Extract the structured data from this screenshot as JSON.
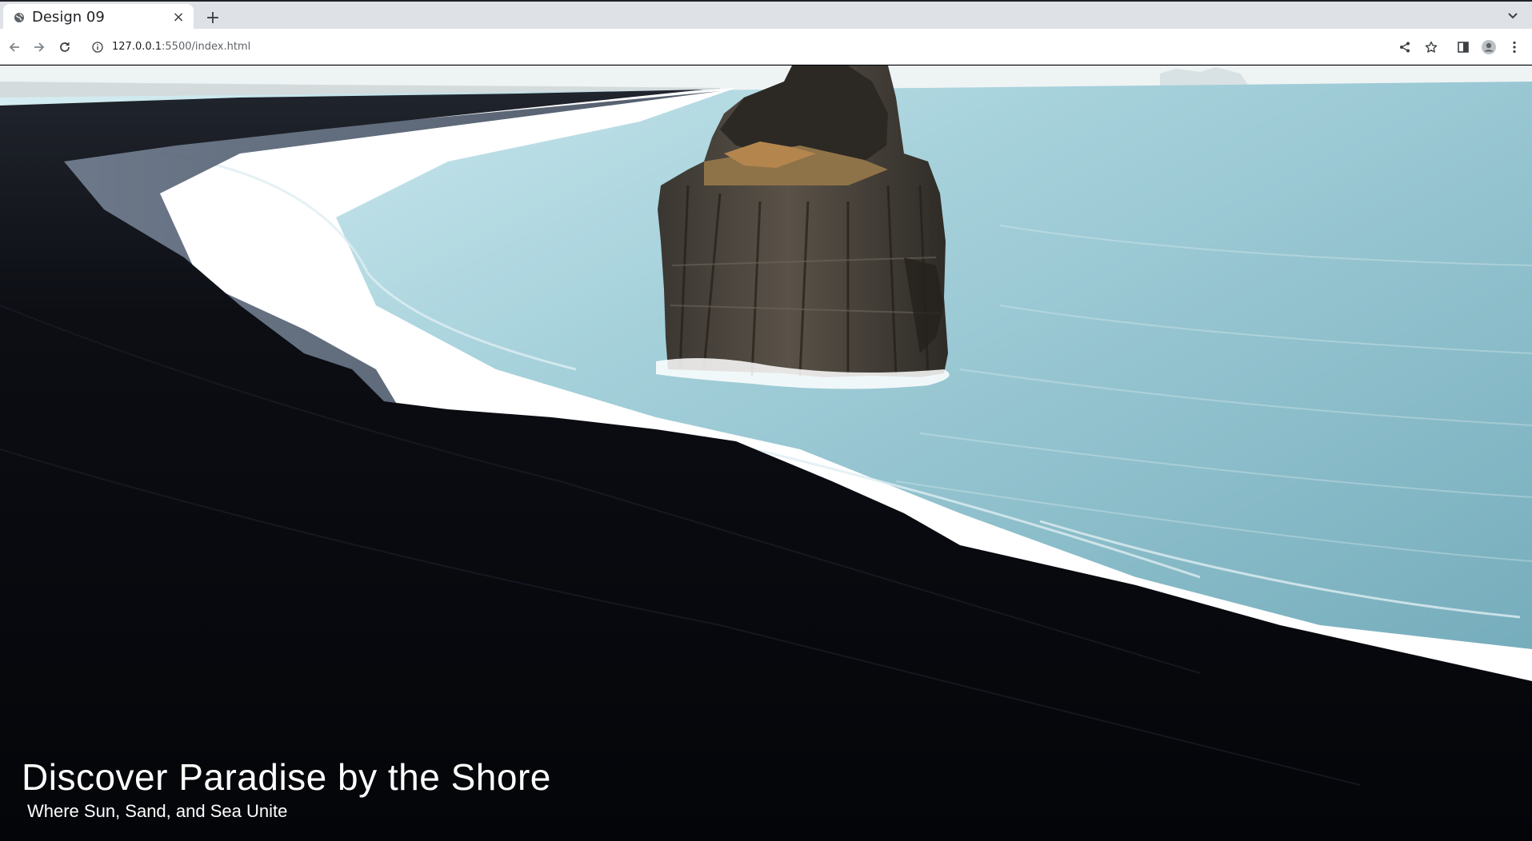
{
  "browser": {
    "tab": {
      "title": "Design 09",
      "favicon": "globe-icon"
    },
    "new_tab_label": "+",
    "close_label": "×",
    "url": {
      "host": "127.0.0.1",
      "rest": ":5500/index.html"
    },
    "icons": [
      "back-icon",
      "forward-icon",
      "reload-icon",
      "info-icon",
      "share-icon",
      "star-icon",
      "side-panel-icon",
      "profile-icon",
      "menu-icon",
      "tab-search-icon"
    ]
  },
  "hero": {
    "title": "Discover Paradise by the Shore",
    "subtitle": "Where Sun, Sand, and Sea Unite"
  },
  "colors": {
    "sand": "#07080d",
    "sea": "#7fb6c4",
    "foam": "#ffffff",
    "mist": "#e6eef0",
    "rock": "#4a443d"
  }
}
